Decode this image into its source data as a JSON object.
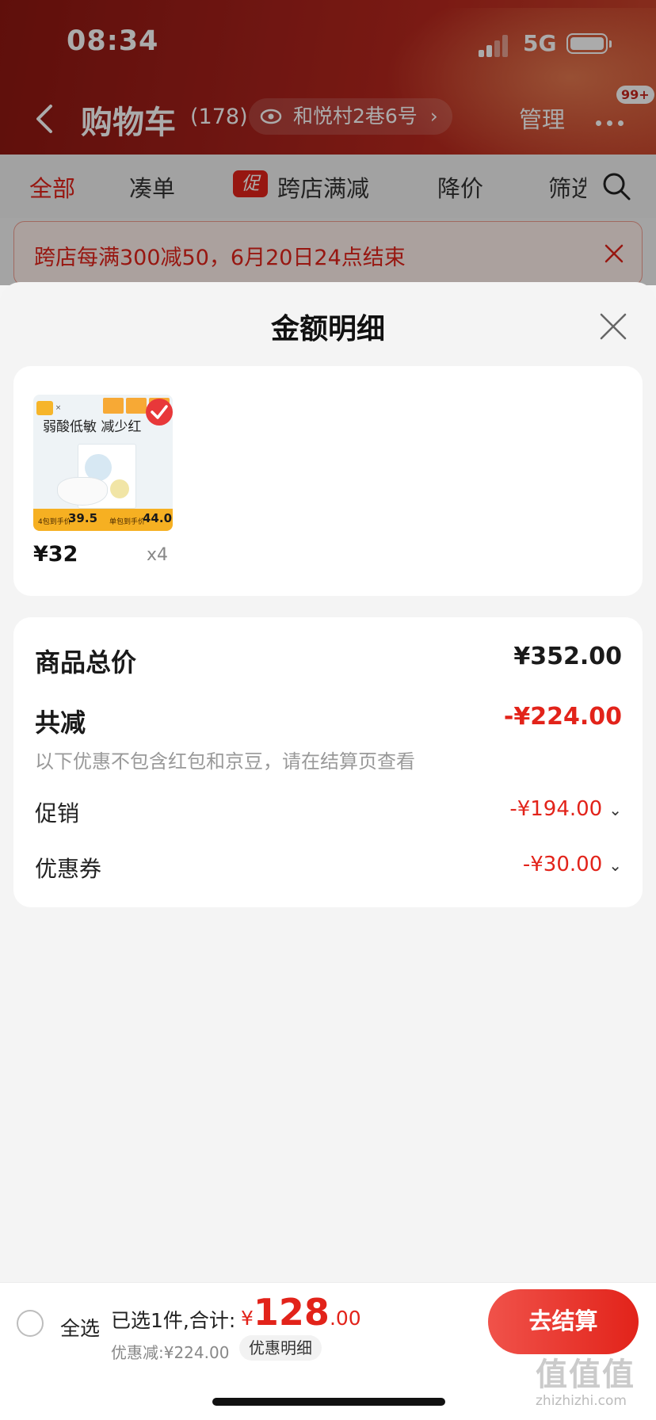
{
  "status": {
    "time": "08:34",
    "network": "5G"
  },
  "nav": {
    "title": "购物车",
    "count": "(178)",
    "location": "和悦村2巷6号",
    "manage": "管理",
    "badge": "99+"
  },
  "filters": {
    "all": "全部",
    "bundle": "凑单",
    "promo_tag": "促",
    "cross_store": "跨店满减",
    "price_drop": "降价",
    "filter": "筛选"
  },
  "promo_banner": {
    "text": "跨店每满300减50，6月20日24点结束"
  },
  "sheet": {
    "title": "金额明细",
    "product": {
      "slogan": "弱酸低敏 减少红",
      "price_bar_left_label": "4包到手价",
      "price_bar_left_value": "39.5",
      "price_bar_right_label": "单包到手价",
      "price_bar_right_value": "44.0",
      "price": "¥32",
      "qty": "x4"
    },
    "summary": {
      "total_label": "商品总价",
      "total_value": "¥352.00",
      "discount_label": "共减",
      "discount_value": "-¥224.00",
      "note": "以下优惠不包含红包和京豆，请在结算页查看",
      "promo_label": "促销",
      "promo_value": "-¥194.00",
      "coupon_label": "优惠券",
      "coupon_value": "-¥30.00"
    }
  },
  "checkout": {
    "select_all": "全选",
    "selected_text": "已选1件,合计:",
    "currency": "¥",
    "total_int": "128",
    "total_dec": ".00",
    "discount_line": "优惠减:¥224.00",
    "detail_chip": "优惠明细",
    "button": "去结算"
  },
  "watermark": {
    "logo": "值值值",
    "site": "zhizhizhi.com"
  },
  "colors": {
    "accent": "#e2231a",
    "header": "#a3201a"
  }
}
